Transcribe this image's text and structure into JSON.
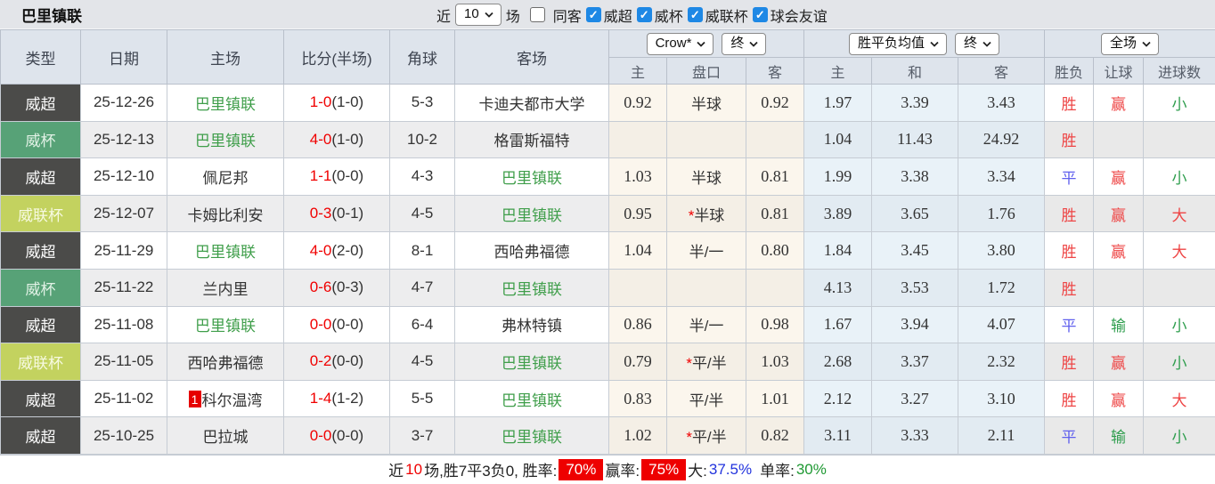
{
  "title": "巴里镇联",
  "topbar": {
    "recent_label": "近",
    "recent_select": "10",
    "matches_label": "场",
    "same_opponent": {
      "label": "同客",
      "checked": false
    },
    "league_filters": [
      {
        "label": "威超",
        "checked": true
      },
      {
        "label": "威杯",
        "checked": true
      },
      {
        "label": "威联杯",
        "checked": true
      },
      {
        "label": "球会友谊",
        "checked": true
      }
    ]
  },
  "table": {
    "columns_left": [
      "类型",
      "日期",
      "主场",
      "比分(半场)",
      "角球",
      "客场"
    ],
    "odds_group": {
      "company_select": "Crow*",
      "time_select": "终",
      "columns": [
        "主",
        "盘口",
        "客"
      ]
    },
    "avg_group": {
      "type_select": "胜平负均值",
      "time_select": "终",
      "columns": [
        "主",
        "和",
        "客"
      ]
    },
    "result_group": {
      "scope_select": "全场",
      "columns": [
        "胜负",
        "让球",
        "进球数"
      ]
    },
    "rows": [
      {
        "league": "威超",
        "league_class": "lg-wc",
        "date": "25-12-26",
        "home": "巴里镇联",
        "home_green": true,
        "home_badge": "",
        "score": "1-0",
        "half": "(1-0)",
        "corner": "5-3",
        "away": "卡迪夫都市大学",
        "away_green": false,
        "odds_home": "0.92",
        "handicap_star": "",
        "handicap": "半球",
        "odds_away": "0.92",
        "avg_home": "1.97",
        "avg_draw": "3.39",
        "avg_away": "3.43",
        "result": "胜",
        "result_class": "win",
        "handicap_result": "赢",
        "handicap_result_class": "win",
        "goals": "小",
        "goals_class": "small"
      },
      {
        "league": "威杯",
        "league_class": "lg-wb",
        "date": "25-12-13",
        "home": "巴里镇联",
        "home_green": true,
        "home_badge": "",
        "score": "4-0",
        "half": "(1-0)",
        "corner": "10-2",
        "away": "格雷斯福特",
        "away_green": false,
        "odds_home": "",
        "handicap_star": "",
        "handicap": "",
        "odds_away": "",
        "avg_home": "1.04",
        "avg_draw": "11.43",
        "avg_away": "24.92",
        "result": "胜",
        "result_class": "win",
        "handicap_result": "",
        "handicap_result_class": "",
        "goals": "",
        "goals_class": ""
      },
      {
        "league": "威超",
        "league_class": "lg-wc",
        "date": "25-12-10",
        "home": "佩尼邦",
        "home_green": false,
        "home_badge": "",
        "score": "1-1",
        "half": "(0-0)",
        "corner": "4-3",
        "away": "巴里镇联",
        "away_green": true,
        "odds_home": "1.03",
        "handicap_star": "",
        "handicap": "半球",
        "odds_away": "0.81",
        "avg_home": "1.99",
        "avg_draw": "3.38",
        "avg_away": "3.34",
        "result": "平",
        "result_class": "draw",
        "handicap_result": "赢",
        "handicap_result_class": "win",
        "goals": "小",
        "goals_class": "small"
      },
      {
        "league": "威联杯",
        "league_class": "lg-wlb",
        "date": "25-12-07",
        "home": "卡姆比利安",
        "home_green": false,
        "home_badge": "",
        "score": "0-3",
        "half": "(0-1)",
        "corner": "4-5",
        "away": "巴里镇联",
        "away_green": true,
        "odds_home": "0.95",
        "handicap_star": "*",
        "handicap": "半球",
        "odds_away": "0.81",
        "avg_home": "3.89",
        "avg_draw": "3.65",
        "avg_away": "1.76",
        "result": "胜",
        "result_class": "win",
        "handicap_result": "赢",
        "handicap_result_class": "win",
        "goals": "大",
        "goals_class": "big"
      },
      {
        "league": "威超",
        "league_class": "lg-wc",
        "date": "25-11-29",
        "home": "巴里镇联",
        "home_green": true,
        "home_badge": "",
        "score": "4-0",
        "half": "(2-0)",
        "corner": "8-1",
        "away": "西哈弗福德",
        "away_green": false,
        "odds_home": "1.04",
        "handicap_star": "",
        "handicap": "半/一",
        "odds_away": "0.80",
        "avg_home": "1.84",
        "avg_draw": "3.45",
        "avg_away": "3.80",
        "result": "胜",
        "result_class": "win",
        "handicap_result": "赢",
        "handicap_result_class": "win",
        "goals": "大",
        "goals_class": "big"
      },
      {
        "league": "威杯",
        "league_class": "lg-wb",
        "date": "25-11-22",
        "home": "兰内里",
        "home_green": false,
        "home_badge": "",
        "score": "0-6",
        "half": "(0-3)",
        "corner": "4-7",
        "away": "巴里镇联",
        "away_green": true,
        "odds_home": "",
        "handicap_star": "",
        "handicap": "",
        "odds_away": "",
        "avg_home": "4.13",
        "avg_draw": "3.53",
        "avg_away": "1.72",
        "result": "胜",
        "result_class": "win",
        "handicap_result": "",
        "handicap_result_class": "",
        "goals": "",
        "goals_class": ""
      },
      {
        "league": "威超",
        "league_class": "lg-wc",
        "date": "25-11-08",
        "home": "巴里镇联",
        "home_green": true,
        "home_badge": "",
        "score": "0-0",
        "half": "(0-0)",
        "corner": "6-4",
        "away": "弗林特镇",
        "away_green": false,
        "odds_home": "0.86",
        "handicap_star": "",
        "handicap": "半/一",
        "odds_away": "0.98",
        "avg_home": "1.67",
        "avg_draw": "3.94",
        "avg_away": "4.07",
        "result": "平",
        "result_class": "draw",
        "handicap_result": "输",
        "handicap_result_class": "lose",
        "goals": "小",
        "goals_class": "small"
      },
      {
        "league": "威联杯",
        "league_class": "lg-wlb",
        "date": "25-11-05",
        "home": "西哈弗福德",
        "home_green": false,
        "home_badge": "",
        "score": "0-2",
        "half": "(0-0)",
        "corner": "4-5",
        "away": "巴里镇联",
        "away_green": true,
        "odds_home": "0.79",
        "handicap_star": "*",
        "handicap": "平/半",
        "odds_away": "1.03",
        "avg_home": "2.68",
        "avg_draw": "3.37",
        "avg_away": "2.32",
        "result": "胜",
        "result_class": "win",
        "handicap_result": "赢",
        "handicap_result_class": "win",
        "goals": "小",
        "goals_class": "small"
      },
      {
        "league": "威超",
        "league_class": "lg-wc",
        "date": "25-11-02",
        "home": "科尔温湾",
        "home_green": false,
        "home_badge": "1",
        "score": "1-4",
        "half": "(1-2)",
        "corner": "5-5",
        "away": "巴里镇联",
        "away_green": true,
        "odds_home": "0.83",
        "handicap_star": "",
        "handicap": "平/半",
        "odds_away": "1.01",
        "avg_home": "2.12",
        "avg_draw": "3.27",
        "avg_away": "3.10",
        "result": "胜",
        "result_class": "win",
        "handicap_result": "赢",
        "handicap_result_class": "win",
        "goals": "大",
        "goals_class": "big"
      },
      {
        "league": "威超",
        "league_class": "lg-wc",
        "date": "25-10-25",
        "home": "巴拉城",
        "home_green": false,
        "home_badge": "",
        "score": "0-0",
        "half": "(0-0)",
        "corner": "3-7",
        "away": "巴里镇联",
        "away_green": true,
        "odds_home": "1.02",
        "handicap_star": "*",
        "handicap": "平/半",
        "odds_away": "0.82",
        "avg_home": "3.11",
        "avg_draw": "3.33",
        "avg_away": "2.11",
        "result": "平",
        "result_class": "draw",
        "handicap_result": "输",
        "handicap_result_class": "lose",
        "goals": "小",
        "goals_class": "small"
      }
    ]
  },
  "summary": {
    "prefix": "近",
    "count": "10",
    "record_text": "场,胜7平3负0, 胜率:",
    "win_rate": "70%",
    "handicap_label": "赢率:",
    "handicap_rate": "75%",
    "big_label": "大:",
    "big_rate": "37.5%",
    "single_label": "单率:",
    "single_rate": "30%"
  },
  "colors": {
    "header_bg": "#dee4ec",
    "league_wc": "#4b4b49",
    "league_wb": "#57a277",
    "league_wlb": "#c3d25f",
    "score_red": "#f00000",
    "team_green": "#3f9e4a",
    "draw_blue": "#5f5fee",
    "badge_red": "#ee0000",
    "big_rate_blue": "#2233dd",
    "single_rate_green": "#1f9933",
    "checkbox_blue": "#1e88e5"
  }
}
